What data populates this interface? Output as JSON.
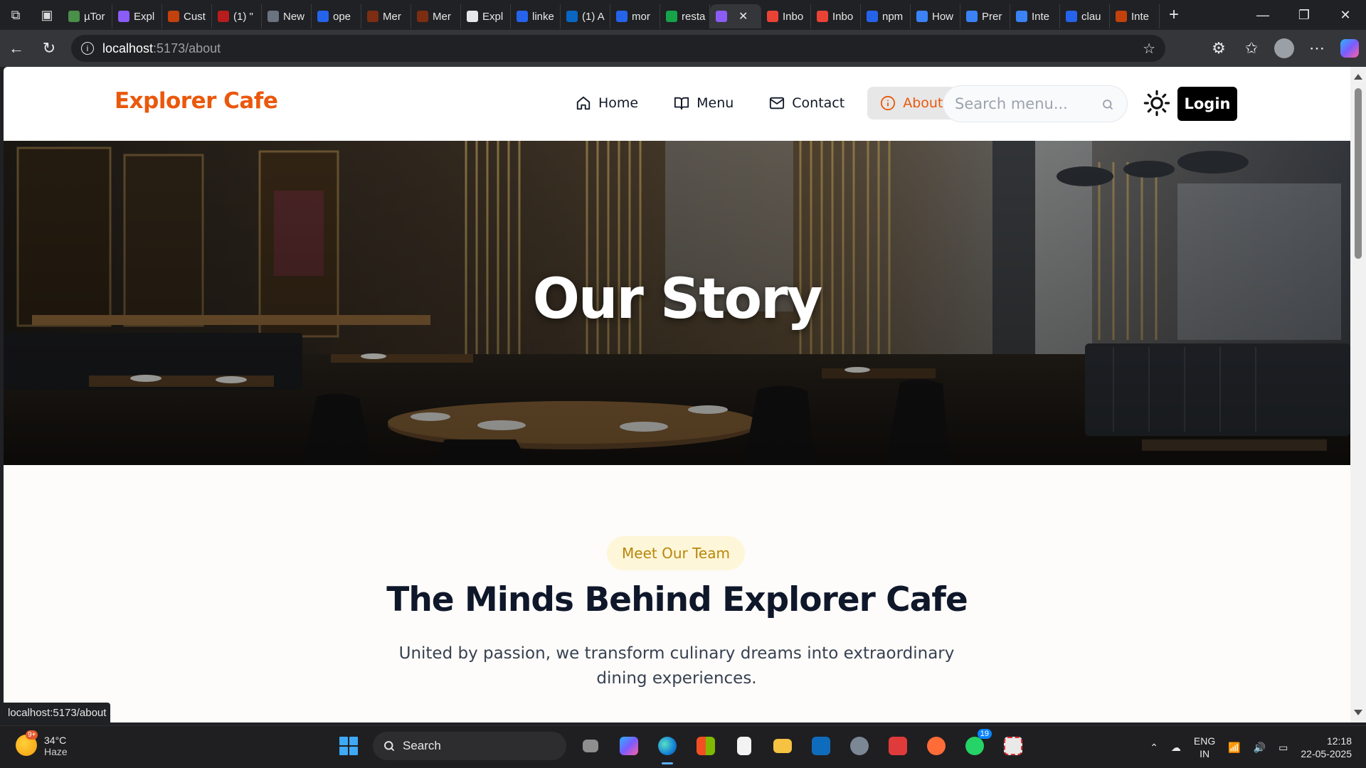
{
  "browser": {
    "tabs": [
      {
        "label": "µTor",
        "color": "#4a8f4a"
      },
      {
        "label": "Expl",
        "color": "#8b5cf6"
      },
      {
        "label": "Cust",
        "color": "#c2410c"
      },
      {
        "label": "(1) \"",
        "color": "#b91c1c"
      },
      {
        "label": "New",
        "color": "#6b7280"
      },
      {
        "label": "ope",
        "color": "#2563eb"
      },
      {
        "label": "Mer",
        "color": "#7c2d12"
      },
      {
        "label": "Mer",
        "color": "#7c2d12"
      },
      {
        "label": "Expl",
        "color": "#e5e7eb"
      },
      {
        "label": "linke",
        "color": "#2563eb"
      },
      {
        "label": "(1) A",
        "color": "#0a66c2"
      },
      {
        "label": "mor",
        "color": "#2563eb"
      },
      {
        "label": "resta",
        "color": "#16a34a"
      },
      {
        "label": "",
        "color": "#8b5cf6",
        "active": true
      },
      {
        "label": "Inbo",
        "color": "#ea4335"
      },
      {
        "label": "Inbo",
        "color": "#ea4335"
      },
      {
        "label": "npm",
        "color": "#2563eb"
      },
      {
        "label": "How",
        "color": "#3b82f6"
      },
      {
        "label": "Prer",
        "color": "#3b82f6"
      },
      {
        "label": "Inte",
        "color": "#3b82f6"
      },
      {
        "label": "clau",
        "color": "#2563eb"
      },
      {
        "label": "Inte",
        "color": "#c2410c"
      }
    ],
    "url_host": "localhost",
    "url_path": ":5173/about",
    "status_url": "localhost:5173/about"
  },
  "nav": {
    "brand": "Explorer Cafe",
    "links": [
      {
        "label": "Home",
        "icon": "home-icon"
      },
      {
        "label": "Menu",
        "icon": "book-open-icon"
      },
      {
        "label": "Contact",
        "icon": "mail-icon"
      },
      {
        "label": "About",
        "icon": "info-icon",
        "active": true
      }
    ],
    "search_placeholder": "Search menu...",
    "login_label": "Login",
    "accent": "#ea580c"
  },
  "hero": {
    "title": "Our Story"
  },
  "team": {
    "badge": "Meet Our Team",
    "title": "The Minds Behind Explorer Cafe",
    "subtitle": "United by passion, we transform culinary dreams into extraordinary dining experiences."
  },
  "taskbar": {
    "weather_temp": "34°C",
    "weather_desc": "Haze",
    "weather_badge": "9+",
    "search_label": "Search",
    "whatsapp_badge": "19",
    "lang_1": "ENG",
    "lang_2": "IN",
    "time": "12:18",
    "date": "22-05-2025"
  }
}
